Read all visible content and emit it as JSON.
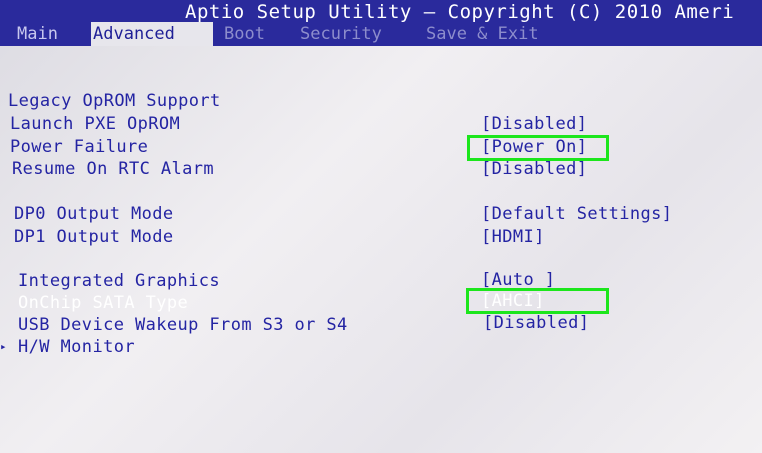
{
  "header": {
    "title": "Aptio Setup Utility – Copyright (C) 2010 Ameri",
    "tabs": [
      {
        "label": "Main"
      },
      {
        "label": "Advanced"
      },
      {
        "label": "Boot"
      },
      {
        "label": "Security"
      },
      {
        "label": "Save & Exit"
      }
    ],
    "active_tab": "Advanced"
  },
  "settings": {
    "section_heading": "Legacy OpROM Support",
    "items": [
      {
        "label": "Launch PXE OpROM",
        "value": "[Disabled]"
      },
      {
        "label": "Power Failure",
        "value": "[Power On]",
        "highlighted": true
      },
      {
        "label": "Resume On RTC Alarm",
        "value": "[Disabled]"
      },
      {
        "label": "DP0 Output Mode",
        "value": "[Default Settings]"
      },
      {
        "label": "DP1 Output Mode",
        "value": "[HDMI]"
      },
      {
        "label": "Integrated Graphics",
        "value": "[Auto ]"
      },
      {
        "label": "OnChip SATA Type",
        "value": "[AHCI]",
        "highlighted": true,
        "selected": true
      },
      {
        "label": "USB Device Wakeup From S3 or S4",
        "value": "[Disabled]"
      },
      {
        "label": "H/W Monitor",
        "submenu": true
      }
    ],
    "submenu_marker": "▸"
  },
  "colors": {
    "header_bg": "#2a2a9c",
    "text": "#2424a3",
    "selected_text": "#ffffff",
    "highlight_box": "#1ce61c"
  }
}
